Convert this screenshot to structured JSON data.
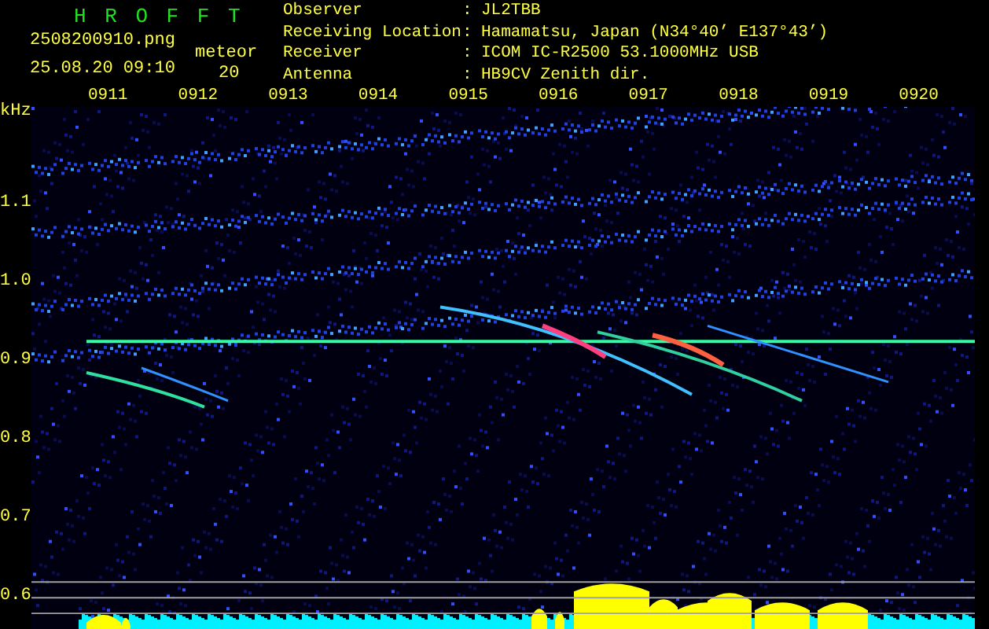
{
  "logo": "H R O F F T",
  "file": {
    "name": "2508200910.png",
    "timestamp": "25.08.20 09:10",
    "count_label": "meteor",
    "count": "20"
  },
  "station": [
    {
      "label": "Observer",
      "sep": ":",
      "value": "JL2TBB"
    },
    {
      "label": "Receiving Location",
      "sep": ":",
      "value": "Hamamatsu, Japan (N34°40’ E137°43’)"
    },
    {
      "label": "Receiver",
      "sep": ":",
      "value": "ICOM IC-R2500 53.1000MHz USB"
    },
    {
      "label": "Antenna",
      "sep": ":",
      "value": "HB9CV Zenith dir."
    }
  ],
  "spectrogram": {
    "unit": "kHz",
    "frequency_labels": [
      "1.1",
      "1.0",
      "0.9",
      "0.8",
      "0.7",
      "0.6"
    ],
    "time_labels": [
      "0911",
      "0912",
      "0913",
      "0914",
      "0915",
      "0916",
      "0917",
      "0918",
      "0919",
      "0920"
    ]
  }
}
